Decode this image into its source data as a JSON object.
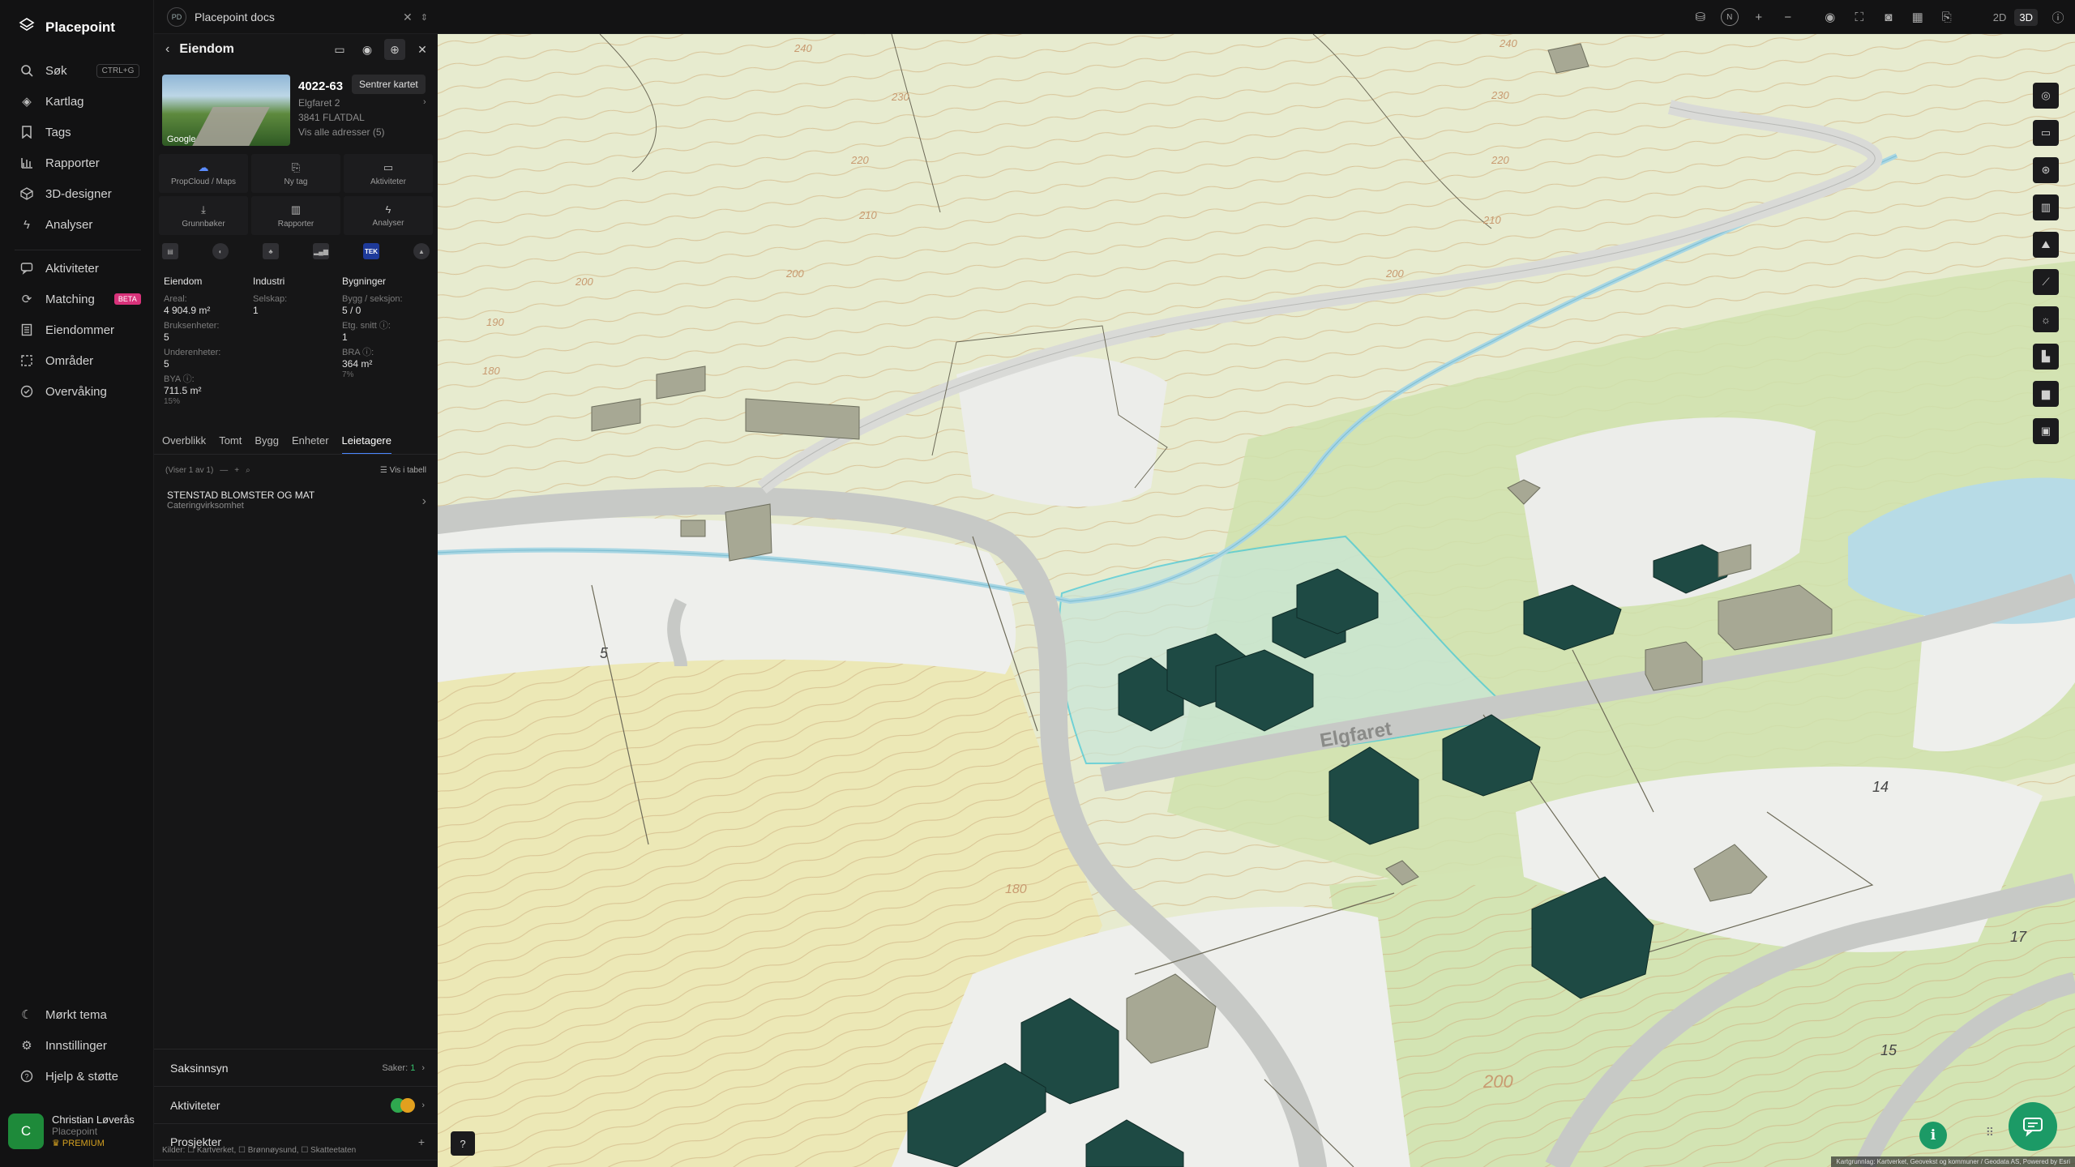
{
  "app": {
    "name": "Placepoint"
  },
  "nav": {
    "primary": [
      {
        "label": "Søk",
        "icon": "search-icon",
        "shortcut": "CTRL+G"
      },
      {
        "label": "Kartlag",
        "icon": "layers-icon"
      },
      {
        "label": "Tags",
        "icon": "bookmark-icon"
      },
      {
        "label": "Rapporter",
        "icon": "bar-chart-icon"
      },
      {
        "label": "3D-designer",
        "icon": "cube-icon"
      },
      {
        "label": "Analyser",
        "icon": "bolt-icon"
      }
    ],
    "secondary": [
      {
        "label": "Aktiviteter",
        "icon": "chat-icon"
      },
      {
        "label": "Matching",
        "icon": "match-icon",
        "badge": "BETA"
      },
      {
        "label": "Eiendommer",
        "icon": "building-icon"
      },
      {
        "label": "Områder",
        "icon": "area-icon"
      },
      {
        "label": "Overvåking",
        "icon": "monitor-icon"
      }
    ],
    "bottom": [
      {
        "label": "Mørkt tema",
        "icon": "moon-icon"
      },
      {
        "label": "Innstillinger",
        "icon": "gear-icon"
      },
      {
        "label": "Hjelp & støtte",
        "icon": "help-icon"
      }
    ],
    "user": {
      "initial": "C",
      "name": "Christian Løverås",
      "org": "Placepoint",
      "plan": "PREMIUM"
    }
  },
  "topbar": {
    "doc_tab": {
      "badge": "PD",
      "title": "Placepoint docs"
    },
    "compass": "N",
    "view_modes": [
      "2D",
      "3D"
    ],
    "active_view": "3D"
  },
  "panel": {
    "title": "Eiendom",
    "tooltip": "Sentrer kartet",
    "photo_credit": "Google",
    "property": {
      "id": "4022-63",
      "address": "Elgfaret 2",
      "postal": "3841 FLATDAL",
      "all_addresses": "Vis alle adresser (5)"
    },
    "actions": [
      {
        "label": "PropCloud / Maps",
        "icon": "cloud-icon"
      },
      {
        "label": "Ny tag",
        "icon": "tag-icon"
      },
      {
        "label": "Aktiviteter",
        "icon": "chat-icon"
      },
      {
        "label": "Grunnbøker",
        "icon": "download-icon"
      },
      {
        "label": "Rapporter",
        "icon": "bar-chart-icon"
      },
      {
        "label": "Analyser",
        "icon": "bolt-icon"
      }
    ],
    "tek_badge": "TEK",
    "stats": {
      "eiendom": {
        "heading": "Eiendom",
        "areal_label": "Areal:",
        "areal_value": "4 904.9 m²",
        "bruks_label": "Bruksenheter:",
        "bruks_value": "5",
        "under_label": "Underenheter:",
        "under_value": "5",
        "bya_label": "BYA ⓘ:",
        "bya_value": "711.5 m²",
        "bya_pct": "15%"
      },
      "industri": {
        "heading": "Industri",
        "selskap_label": "Selskap:",
        "selskap_value": "1"
      },
      "bygninger": {
        "heading": "Bygninger",
        "bygg_label": "Bygg / seksjon:",
        "bygg_value": "5 / 0",
        "etg_label": "Etg. snitt ⓘ:",
        "etg_value": "1",
        "bra_label": "BRA ⓘ:",
        "bra_value": "364 m²",
        "bra_pct": "7%"
      }
    },
    "tabs": [
      "Overblikk",
      "Tomt",
      "Bygg",
      "Enheter",
      "Leietagere"
    ],
    "active_tab": "Leietagere",
    "list_info": "(Viser 1 av 1)",
    "table_toggle": "Vis i tabell",
    "tenants": [
      {
        "name": "STENSTAD BLOMSTER OG MAT",
        "type": "Cateringvirksomhet"
      }
    ],
    "accordions": {
      "saksinnsyn": {
        "label": "Saksinnsyn",
        "meta_label": "Saker:",
        "meta_value": "1"
      },
      "aktiviteter": {
        "label": "Aktiviteter"
      },
      "prosjekter": {
        "label": "Prosjekter",
        "action": "+"
      }
    },
    "sources": "Kilder: ☐ Kartverket, ☐ Brønnøysund, ☐ Skatteetaten"
  },
  "map": {
    "road_name": "Elgfaret",
    "contour_labels": [
      "240",
      "230",
      "220",
      "210",
      "200",
      "200",
      "190",
      "180",
      "200",
      "210",
      "220",
      "230",
      "240",
      "200",
      "180"
    ],
    "plot_numbers": [
      "5",
      "14",
      "15",
      "17"
    ],
    "attribution": "Kartgrunnlag: Kartverket, Geovekst og kommuner / Geodata AS, Powered by Esri",
    "colors": {
      "building_selected": "#1e4a44",
      "building_other": "#a7a894",
      "parcel_outline": "#3ec7d9",
      "water": "#a8d6e3",
      "grass": "#d6e4b4",
      "field": "#ebe8b8"
    }
  }
}
